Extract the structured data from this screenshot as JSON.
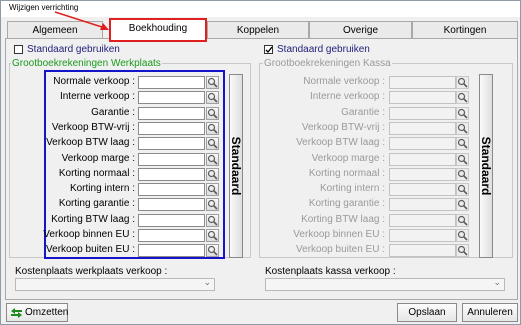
{
  "window": {
    "title": "Wijzigen verrichting"
  },
  "tabs": [
    {
      "label": "Algemeen"
    },
    {
      "label": "Boekhouding"
    },
    {
      "label": "Koppelen"
    },
    {
      "label": "Overige"
    },
    {
      "label": "Kortingen"
    }
  ],
  "left": {
    "checkbox_label": "Standaard gebruiken",
    "checkbox_checked": false,
    "group_label": "Grootboekrekeningen Werkplaats",
    "fields": [
      {
        "label": "Normale verkoop :",
        "value": ""
      },
      {
        "label": "Interne verkoop :",
        "value": ""
      },
      {
        "label": "Garantie :",
        "value": ""
      },
      {
        "label": "Verkoop BTW-vrij :",
        "value": ""
      },
      {
        "label": "Verkoop BTW laag :",
        "value": ""
      },
      {
        "label": "Verkoop marge :",
        "value": ""
      },
      {
        "label": "Korting normaal :",
        "value": ""
      },
      {
        "label": "Korting intern :",
        "value": ""
      },
      {
        "label": "Korting garantie :",
        "value": ""
      },
      {
        "label": "Korting BTW laag :",
        "value": ""
      },
      {
        "label": "Verkoop binnen EU :",
        "value": ""
      },
      {
        "label": "Verkoop buiten EU :",
        "value": ""
      }
    ],
    "standaard_button": "Standaard",
    "kostenplaats_label": "Kostenplaats werkplaats verkoop :",
    "kostenplaats_value": ""
  },
  "right": {
    "checkbox_label": "Standaard gebruiken",
    "checkbox_checked": true,
    "group_label": "Grootboekrekeningen Kassa",
    "fields": [
      {
        "label": "Normale verkoop :",
        "value": ""
      },
      {
        "label": "Interne verkoop :",
        "value": ""
      },
      {
        "label": "Garantie :",
        "value": ""
      },
      {
        "label": "Verkoop BTW-vrij :",
        "value": ""
      },
      {
        "label": "Verkoop BTW laag :",
        "value": ""
      },
      {
        "label": "Verkoop marge :",
        "value": ""
      },
      {
        "label": "Korting normaal :",
        "value": ""
      },
      {
        "label": "Korting intern :",
        "value": ""
      },
      {
        "label": "Korting garantie :",
        "value": ""
      },
      {
        "label": "Korting BTW laag :",
        "value": ""
      },
      {
        "label": "Verkoop binnen EU :",
        "value": ""
      },
      {
        "label": "Verkoop buiten EU :",
        "value": ""
      }
    ],
    "standaard_button": "Standaard",
    "kostenplaats_label": "Kostenplaats kassa verkoop :",
    "kostenplaats_value": ""
  },
  "footer": {
    "omzetten_label": "Omzetten",
    "opslaan_label": "Opslaan",
    "annuleren_label": "Annuleren"
  },
  "colors": {
    "group_label_green": "#1a9a1a",
    "checkbox_label_navy": "#1f1f7a",
    "annotation_red": "#e02020",
    "highlight_blue": "#1414c8"
  },
  "icons": [
    "magnifier-icon",
    "omzetten-arrows-icon",
    "dropdown-arrow-icon"
  ]
}
